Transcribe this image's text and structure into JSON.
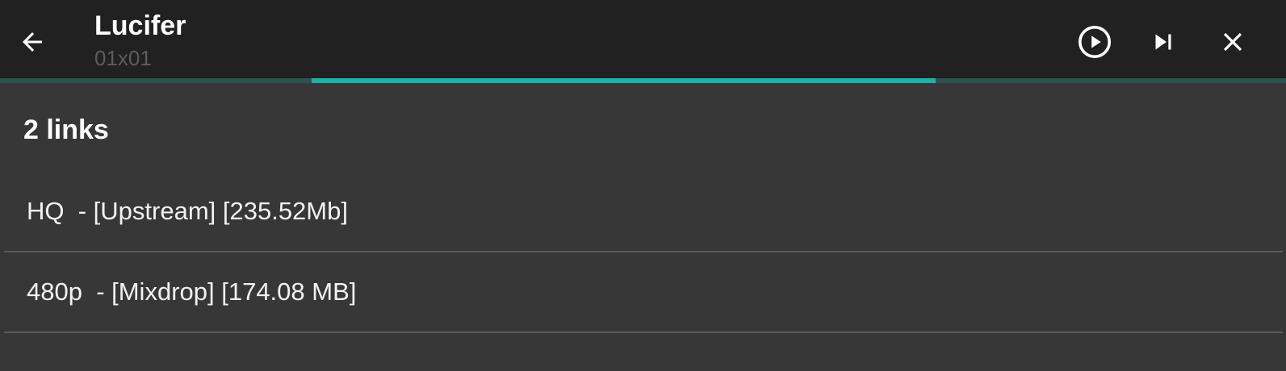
{
  "header": {
    "title": "Lucifer",
    "subtitle": "01x01"
  },
  "progress": {
    "start_fraction": 0.242,
    "end_fraction": 0.727
  },
  "links": {
    "count_label": "2 links",
    "items": [
      {
        "label": "HQ  - [Upstream] [235.52Mb]"
      },
      {
        "label": "480p  - [Mixdrop] [174.08 MB]"
      }
    ]
  },
  "colors": {
    "topbar": "#212121",
    "background": "#373737",
    "accent": "#1bb3a8"
  },
  "icons": {
    "back": "arrow-left",
    "play": "play-circle",
    "next": "skip-next",
    "close": "close"
  }
}
